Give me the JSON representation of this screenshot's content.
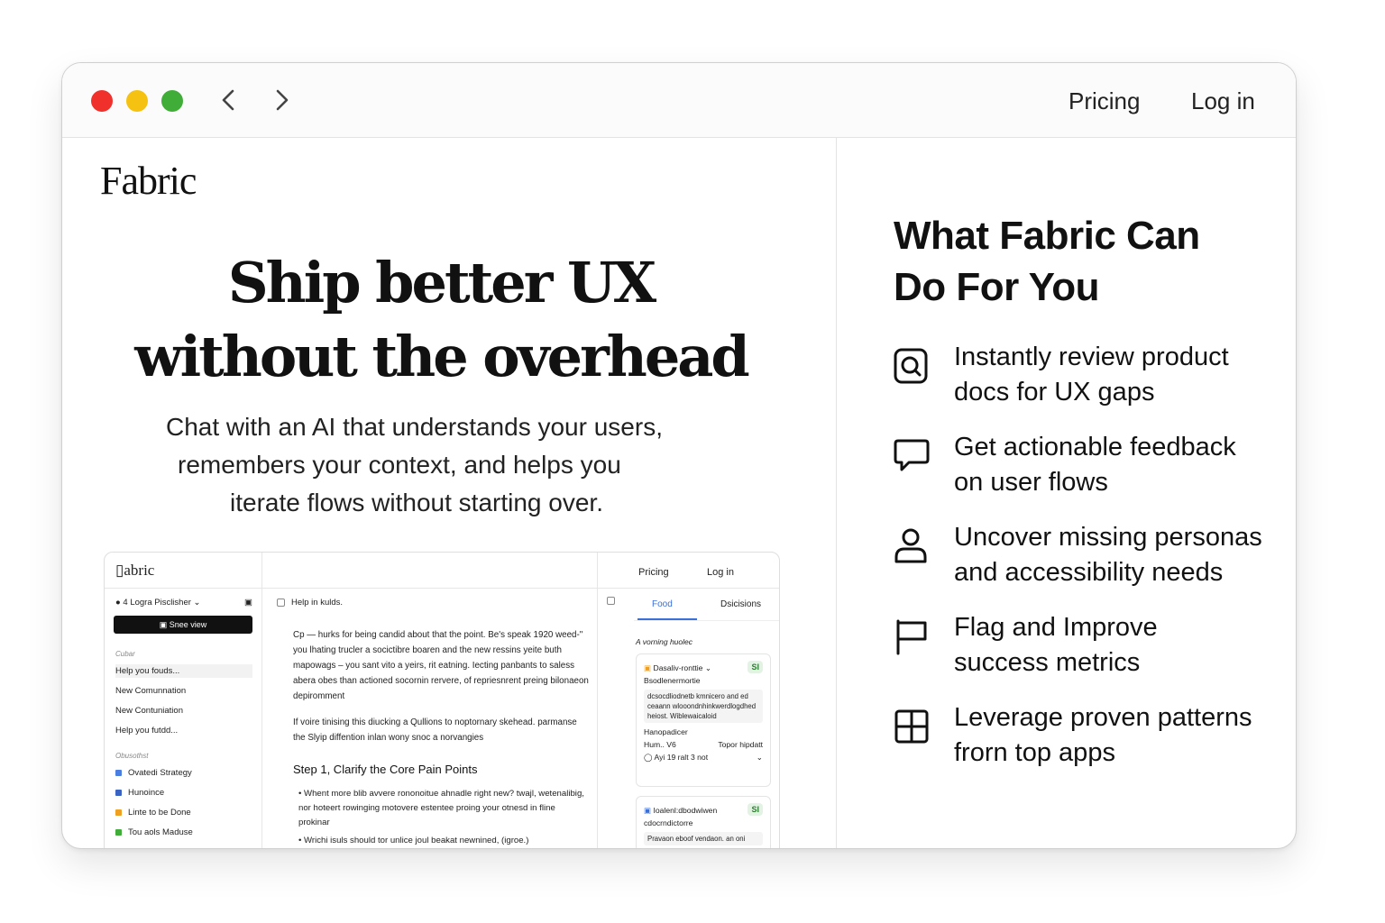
{
  "nav": {
    "pricing": "Pricing",
    "login": "Log in"
  },
  "brand": "Fabric",
  "hero": {
    "line1": "Ship better UX",
    "line2": "without the overhead"
  },
  "subtitle": {
    "line1": "Chat with an AI that understands your users,",
    "line2": "remembers your context, and helps you",
    "line3": "iterate flows without starting over."
  },
  "preview": {
    "brand": "abric",
    "pricing": "Pricing",
    "login": "Log in",
    "workspace": "4 Logra Pisclisher",
    "button": "Snee view",
    "section1": "Cubar",
    "items1": [
      "Help you fouds...",
      "New Comunnation",
      "New Contuniation",
      "Help you futdd..."
    ],
    "section2": "Obusothst",
    "items2": [
      "Ovatedi Strategy",
      "Hunoince",
      "Linte to be Done",
      "Tou aols Maduse"
    ],
    "main_header": "Help in kulds.",
    "para1": "Cp — hurks for being candid about that the point. Be's speak 1920 weed-\" you lhating trucler a socictibre boaren and the new ressins yeite buth mapowags – you sant vito a yeirs, rit eatning. Iecting panbants to saless abera obes than actioned socornin rervere, of repriesnrent preing bilonaeon depiromment",
    "para2": "If voire tinising this diucking a Qullions to noptornary skehead. parmanse the Slyip diffention inlan wony snoc a norvangies",
    "step": "Step 1, Clarify the Core Pain Points",
    "bullet1": "Whent more blib avvere rononoitue ahnadle right new? twajl, wetenalibig, nor hoteert rowinging motovere estentee proing your otnesd in fline prokinar",
    "bullet2": "Wrichi isuls should tor unlice joul beakat newnined, (igroe.)",
    "tab1": "Food",
    "tab2": "Dsicisions",
    "hint": "A vorning huolec",
    "card1": {
      "title": "Dasaliv-ronttie",
      "badge": "SI",
      "sub": "Bsodlenermortie",
      "box": "dcsocdliodnetb kmnicero and ed ceaann wlooondnhinkwerdlogdhed heiost. Wiblewaicaloid",
      "label": "Hanopadicer",
      "meta1": "Hum.. V6",
      "meta2": "Topor hipdatt",
      "footer": "Ayi 19 ralt 3 not"
    },
    "card2": {
      "title": "Ioalenl:dbodwiwen",
      "badge": "SI",
      "sub": "cdocrndictorre",
      "box": "Pravaon eboof vendaon. an oni"
    }
  },
  "right": {
    "title_line1": "What Fabric Can",
    "title_line2": "Do For You",
    "features": [
      {
        "icon": "search-doc-icon",
        "line1": "Instantly review product",
        "line2": "docs for UX gaps"
      },
      {
        "icon": "chat-bubble-icon",
        "line1": "Get actionable feedback",
        "line2": "on user flows"
      },
      {
        "icon": "person-icon",
        "line1": "Uncover missing personas",
        "line2": "and accessibility needs"
      },
      {
        "icon": "flag-icon",
        "line1": "Flag and Improve",
        "line2": "success metrics"
      },
      {
        "icon": "grid-icon",
        "line1": "Leverage proven patterns",
        "line2": "frorn top apps"
      }
    ]
  },
  "colors": {
    "close": "#f0302b",
    "minimize": "#f5c212",
    "maximize": "#3fad38",
    "accent": "#3a6fd8"
  }
}
